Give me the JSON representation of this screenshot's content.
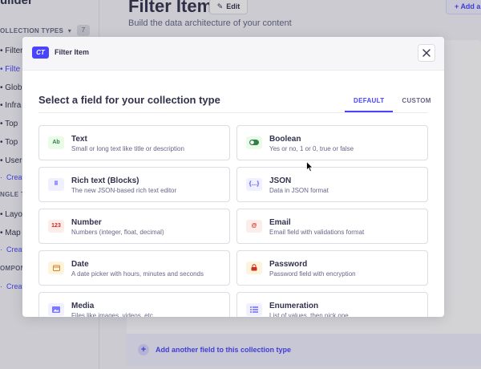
{
  "background": {
    "brand": "uilder",
    "sidebar": {
      "collection_types_label": "OLLECTION TYPES",
      "collection_count": "7",
      "items": [
        {
          "label": "Filter"
        },
        {
          "label": "Filte",
          "active": true
        },
        {
          "label": "Glob"
        },
        {
          "label": "Infra"
        },
        {
          "label": "Top"
        },
        {
          "label": "Top"
        },
        {
          "label": "User"
        }
      ],
      "create_link_1": "Creat",
      "single_types_label": "NGLE TYPES",
      "single_items": [
        {
          "label": "Layo"
        },
        {
          "label": "Map"
        }
      ],
      "create_link_2": "Creat",
      "components_label": "OMPONE",
      "create_link_3": "Creat"
    },
    "header": {
      "title": "Filter Item",
      "edit_label": "Edit",
      "subtitle": "Build the data architecture of your content",
      "add_label": "Add a"
    },
    "add_field_label": "Add another field to this collection type"
  },
  "modal": {
    "badge": "CT",
    "title": "Filter Item",
    "section_title": "Select a field for your collection type",
    "tabs": [
      {
        "label": "DEFAULT",
        "active": true
      },
      {
        "label": "CUSTOM",
        "active": false
      }
    ],
    "fields": [
      {
        "name": "Text",
        "description": "Small or long text like title or description",
        "icon": "text-icon",
        "icon_glyph": "Ab",
        "icon_bg": "#eafbe7",
        "icon_color": "#328048"
      },
      {
        "name": "Boolean",
        "description": "Yes or no, 1 or 0, true or false",
        "icon": "toggle-icon",
        "icon_glyph": "",
        "icon_bg": "#eafbe7",
        "icon_color": "#328048"
      },
      {
        "name": "Rich text (Blocks)",
        "description": "The new JSON-based rich text editor",
        "icon": "blocks-icon",
        "icon_glyph": "⠿",
        "icon_bg": "#f0f0ff",
        "icon_color": "#4945ff"
      },
      {
        "name": "JSON",
        "description": "Data in JSON format",
        "icon": "json-icon",
        "icon_glyph": "{…}",
        "icon_bg": "#f0f0ff",
        "icon_color": "#4945ff"
      },
      {
        "name": "Number",
        "description": "Numbers (integer, float, decimal)",
        "icon": "number-icon",
        "icon_glyph": "123",
        "icon_bg": "#fcecea",
        "icon_color": "#d02b20"
      },
      {
        "name": "Email",
        "description": "Email field with validations format",
        "icon": "email-icon",
        "icon_glyph": "@",
        "icon_bg": "#fcecea",
        "icon_color": "#d02b20"
      },
      {
        "name": "Date",
        "description": "A date picker with hours, minutes and seconds",
        "icon": "calendar-icon",
        "icon_glyph": "▭",
        "icon_bg": "#fdf4dc",
        "icon_color": "#d9822f"
      },
      {
        "name": "Password",
        "description": "Password field with encryption",
        "icon": "lock-icon",
        "icon_glyph": "🔒",
        "icon_bg": "#fdf4dc",
        "icon_color": "#d02b20"
      },
      {
        "name": "Media",
        "description": "Files like images, videos, etc",
        "icon": "media-icon",
        "icon_glyph": "▣",
        "icon_bg": "#f0f0ff",
        "icon_color": "#7b79ff"
      },
      {
        "name": "Enumeration",
        "description": "List of values, then pick one",
        "icon": "list-icon",
        "icon_glyph": "☰",
        "icon_bg": "#f0f0ff",
        "icon_color": "#4945ff"
      }
    ]
  }
}
